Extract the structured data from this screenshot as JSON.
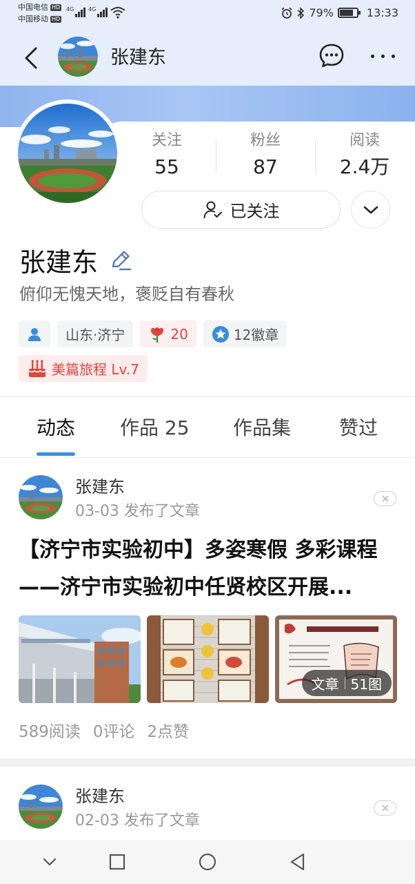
{
  "status_bar": {
    "carrier_1": "中国电信",
    "carrier_2": "中国移动",
    "hd_badge": "HD",
    "network_1": "4G",
    "network_2": "4G",
    "battery_text": "79%",
    "battery_level": 0.79,
    "time": "13:33"
  },
  "header": {
    "title": "张建东",
    "back_icon": "chevron-left-icon",
    "message_icon": "chat-bubble-icon",
    "more_icon": "ellipsis-icon"
  },
  "profile": {
    "stats": [
      {
        "label": "关注",
        "value": "55"
      },
      {
        "label": "粉丝",
        "value": "87"
      },
      {
        "label": "阅读",
        "value": "2.4万"
      }
    ],
    "follow_label": "已关注",
    "name": "张建东",
    "signature": "俯仰无愧天地，褒贬自有春秋",
    "location": "山东·济宁",
    "flower_count": "20",
    "badges": "12徽章",
    "journey": "美篇旅程 Lv.7"
  },
  "tabs": [
    {
      "label": "动态",
      "active": true
    },
    {
      "label": "作品 25",
      "active": false
    },
    {
      "label": "作品集",
      "active": false
    },
    {
      "label": "赞过",
      "active": false
    }
  ],
  "feed": [
    {
      "author": "张建东",
      "meta": "03-03 发布了文章",
      "title": "【济宁市实验初中】多姿寒假 多彩课程——济宁市实验初中任贤校区开展...",
      "badge_type": "文章",
      "badge_count": "51图",
      "reads": "589阅读",
      "comments": "0评论",
      "likes": "2点赞"
    },
    {
      "author": "张建东",
      "meta": "02-03 发布了文章"
    }
  ],
  "colors": {
    "accent": "#3c8fe0",
    "header_bg": "#e6eefb",
    "badge_red": "#e0463c"
  }
}
